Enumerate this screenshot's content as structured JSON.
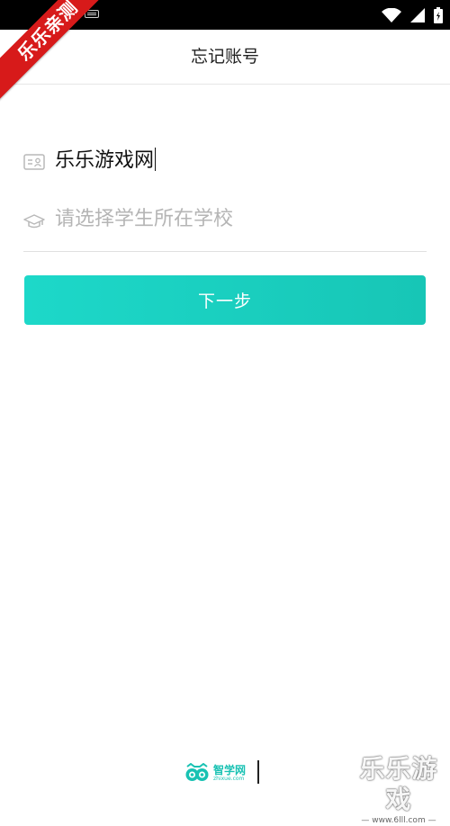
{
  "ribbon": {
    "text": "乐乐亲测"
  },
  "header": {
    "title": "忘记账号"
  },
  "form": {
    "account_value": "乐乐游戏网",
    "school_placeholder": "请选择学生所在学校"
  },
  "actions": {
    "next_label": "下一步"
  },
  "footer": {
    "logo_main": "智学网",
    "logo_sub": "zhixue.com"
  },
  "watermark": {
    "main": "乐乐游戏",
    "sub": "— www.6lll.com —"
  },
  "colors": {
    "accent": "#19c8b8",
    "ribbon": "#d71a1a",
    "placeholder": "#b5b5b5"
  },
  "icons": {
    "status": [
      "keyboard-icon",
      "wifi-icon",
      "signal-icon",
      "battery-icon"
    ],
    "back": "chevron-left-icon",
    "account_field": "id-card-icon",
    "school_field": "graduation-cap-icon"
  }
}
